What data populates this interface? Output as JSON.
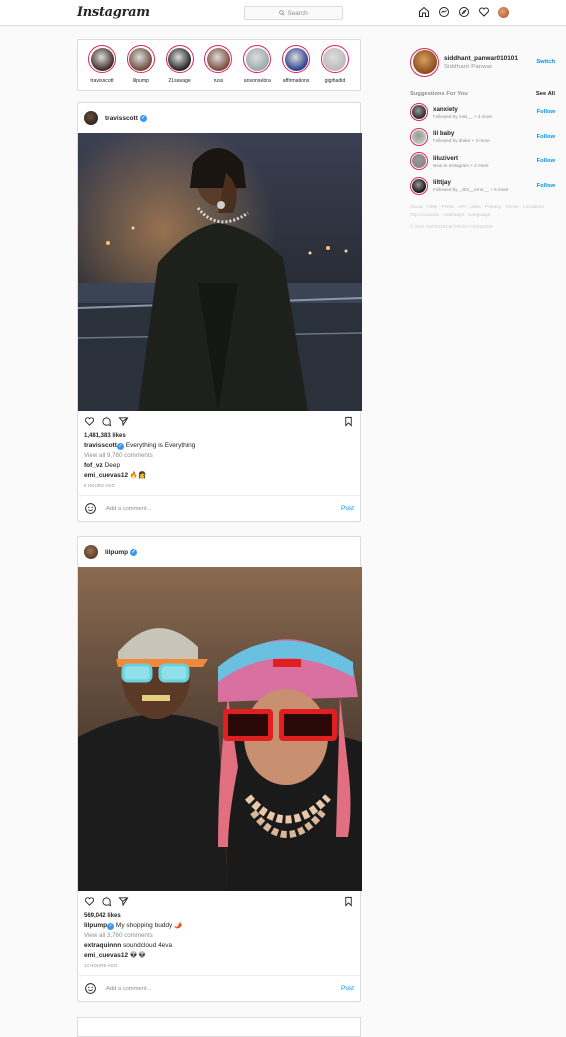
{
  "header": {
    "logo": "Instagram",
    "search_placeholder": "Search",
    "icons": [
      "home-icon",
      "messenger-icon",
      "explore-icon",
      "heart-icon",
      "profile-avatar"
    ]
  },
  "stories": [
    {
      "name": "travisscott",
      "color": "#3a2a22"
    },
    {
      "name": "lilpump",
      "color": "#6b4a3a"
    },
    {
      "name": "21savage",
      "color": "#222"
    },
    {
      "name": "russ",
      "color": "#7a4a3a"
    },
    {
      "name": "ansonsebra",
      "color": "#9aa"
    },
    {
      "name": "affirmations",
      "color": "#2b3d8f"
    },
    {
      "name": "gigihadid",
      "color": "#bbb"
    }
  ],
  "posts": [
    {
      "username": "travisscott",
      "likes": "1,481,383 likes",
      "caption_user": "travisscott",
      "caption": "Everything is Everything",
      "view_all": "View all 9,760 comments",
      "comments": [
        {
          "user": "fof_vz",
          "text": "Deep"
        },
        {
          "user": "emi_cuevas12",
          "text": "🔥👩"
        }
      ],
      "time": "8 HOURS AGO",
      "add_comment": "Add a comment...",
      "post_label": "Post"
    },
    {
      "username": "lilpump",
      "likes": "569,042 likes",
      "caption_user": "lilpump",
      "caption": "My shopping buddy 🌶️",
      "view_all": "View all 3,760 comments",
      "comments": [
        {
          "user": "extraquinnn",
          "text": "soundcloud 4eva"
        },
        {
          "user": "emi_cuevas12",
          "text": "👽👽"
        }
      ],
      "time": "13 HOURS AGO",
      "add_comment": "Add a comment...",
      "post_label": "Post"
    }
  ],
  "sidebar": {
    "username": "siddhant_panwar010101",
    "fullname": "Siddhant Panwar",
    "switch": "Switch",
    "suggestions_title": "Suggestions For You",
    "see_all": "See All",
    "suggestions": [
      {
        "name": "xanxiety",
        "desc": "Followed by russ__ + 4 more",
        "follow": "Follow"
      },
      {
        "name": "lil baby",
        "desc": "Followed by drake + 3 more",
        "follow": "Follow"
      },
      {
        "name": "liluzivert",
        "desc": "New to Instagram + 2 more",
        "follow": "Follow"
      },
      {
        "name": "lilttjay",
        "desc": "Followed by _404__error__ + 6 more",
        "follow": "Follow"
      }
    ],
    "footer_line1": "About · Help · Press · API · Jobs · Privacy · Terms · Locations",
    "footer_line2": "Top Accounts · Hashtags · Language",
    "copyright": "© 2021 INSTAGRAM FROM FACEBOOK"
  },
  "colors": {
    "accent": "#0095f6",
    "verified": "#3897f0",
    "story_ring": "#e0245e"
  }
}
